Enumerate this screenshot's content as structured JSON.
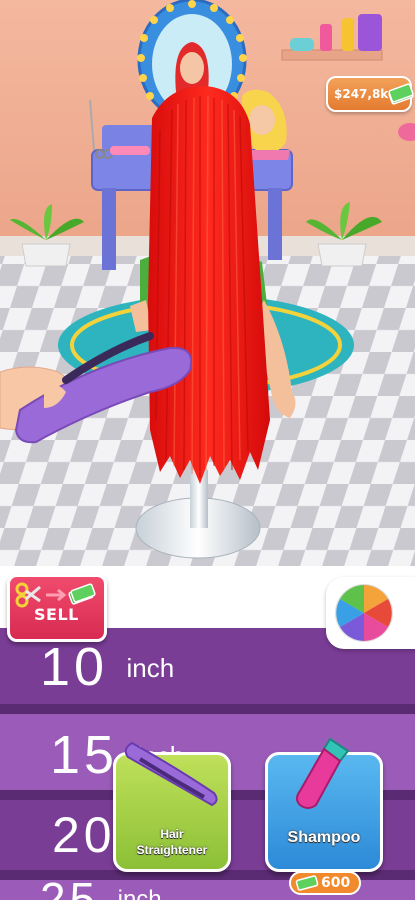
{
  "hud": {
    "money": "$247,8k",
    "sell_label": "SELL"
  },
  "length_rows": [
    {
      "number": "10",
      "unit": "inch"
    },
    {
      "number": "15",
      "unit": "inch"
    },
    {
      "number": "20",
      "unit": "inch"
    },
    {
      "number": "25",
      "unit": "inch"
    }
  ],
  "tools": [
    {
      "name": "Hair Straightener",
      "lines": [
        "Hair",
        "Straightener"
      ],
      "icon": "hair-straightener-icon",
      "color": "#9ccc3a"
    },
    {
      "name": "Shampoo",
      "lines": [
        "Shampoo"
      ],
      "icon": "shampoo-bottle-icon",
      "color": "#3aa0e6",
      "price": "600"
    }
  ],
  "colors": {
    "hair": "#f41818",
    "row_purple": "#7a3d96",
    "row_light": "#9a5cb8",
    "sell_button": "#e23a5e"
  }
}
